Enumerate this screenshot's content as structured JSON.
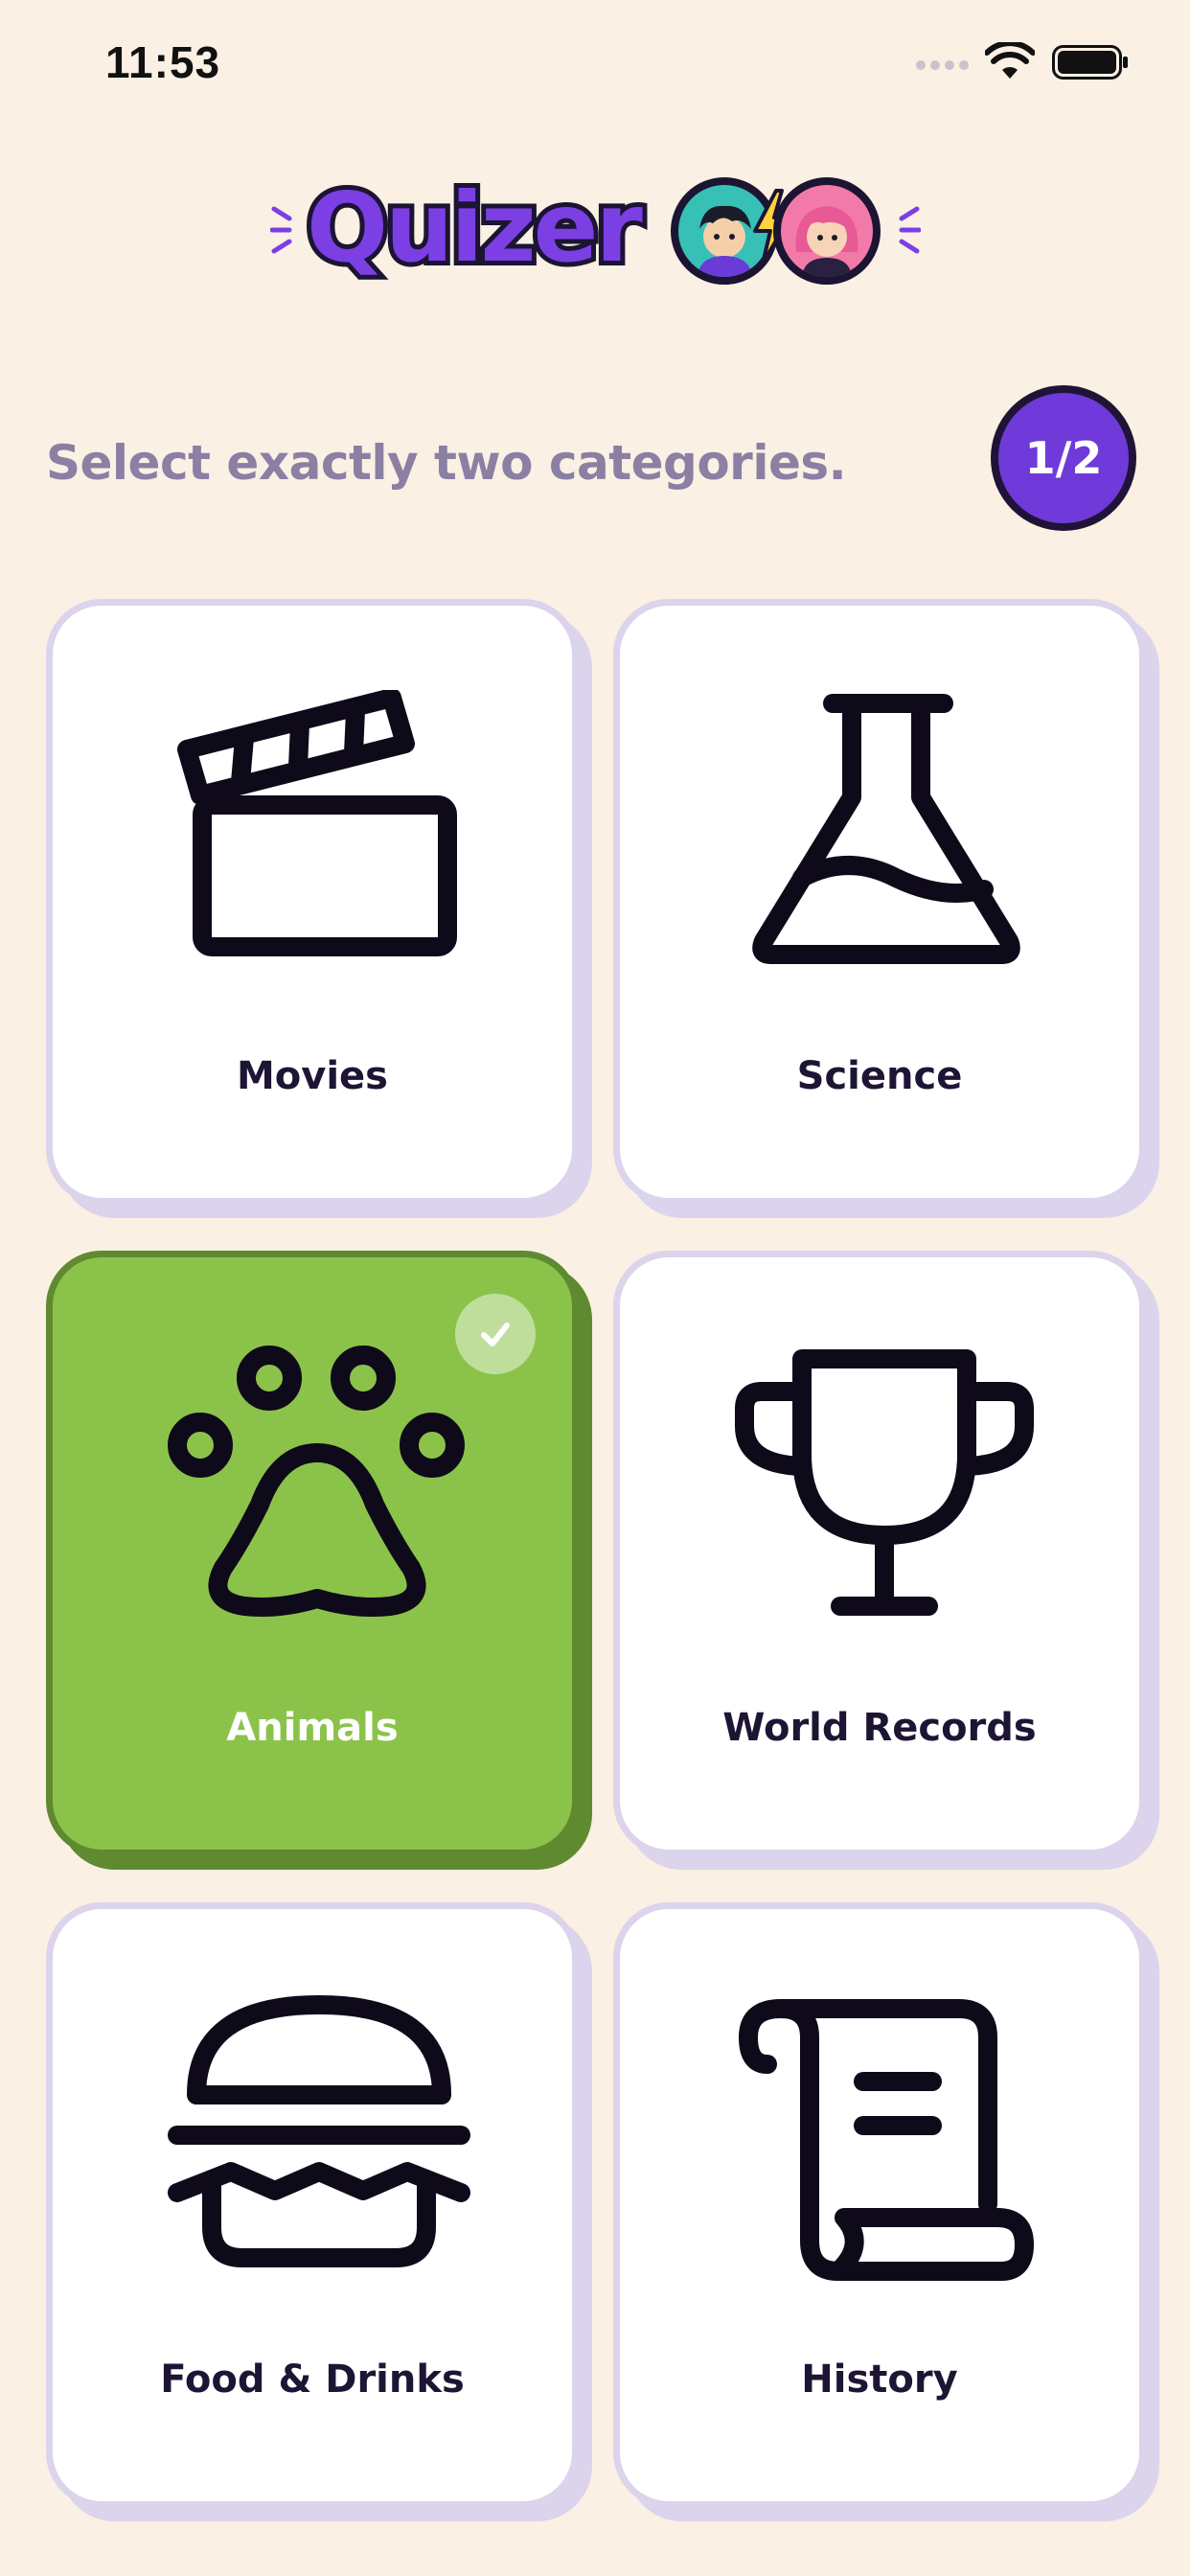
{
  "status_bar": {
    "time": "11:53"
  },
  "header": {
    "logo_text": "Quizer"
  },
  "prompt": {
    "text": "Select exactly two categories.",
    "counter": "1/2"
  },
  "categories": [
    {
      "label": "Movies",
      "icon": "clapperboard-icon",
      "selected": false
    },
    {
      "label": "Science",
      "icon": "flask-icon",
      "selected": false
    },
    {
      "label": "Animals",
      "icon": "paw-icon",
      "selected": true
    },
    {
      "label": "World Records",
      "icon": "trophy-icon",
      "selected": false
    },
    {
      "label": "Food & Drinks",
      "icon": "burger-icon",
      "selected": false
    },
    {
      "label": "History",
      "icon": "scroll-icon",
      "selected": false
    }
  ],
  "colors": {
    "background": "#FAF0E3",
    "accent_purple": "#6F3AD9",
    "selected_green": "#8BC34A",
    "card_border": "#DCD3EC",
    "prompt_text": "#8B7FA3"
  }
}
